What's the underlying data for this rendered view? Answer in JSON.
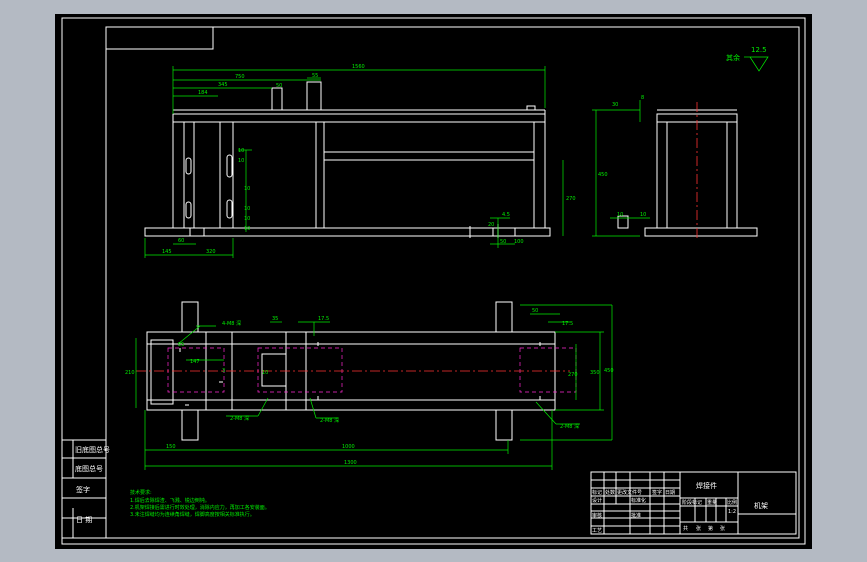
{
  "drawing": {
    "background_color": "#000000",
    "line_color": "#ffffff",
    "dimension_color": "#00ee00",
    "centerline_color": "#ff3333",
    "hidden_line_color": "#ff2ad4"
  },
  "surface_finish": {
    "label": "其余",
    "value": "12.5"
  },
  "front_view": {
    "dims": [
      "1560",
      "750",
      "345",
      "184",
      "55",
      "50",
      "10",
      "10",
      "10",
      "10",
      "10",
      "10",
      "270",
      "60",
      "145",
      "320",
      "4.5",
      "20",
      "50",
      "100"
    ]
  },
  "side_view": {
    "dims": [
      "30",
      "8",
      "450",
      "10",
      "10"
    ]
  },
  "top_view": {
    "dims": [
      "4-M8 深",
      "25",
      "147",
      "3",
      "10",
      "2-M8 深",
      "35",
      "17.5",
      "2-M8 深",
      "50",
      "17.5",
      "270",
      "350",
      "450",
      "2-M8 深",
      "150",
      "1000",
      "1300",
      "210"
    ]
  },
  "side_labels": [
    "旧底图总号",
    "底图总号",
    "签字",
    "日 期"
  ],
  "notes": {
    "title": "技术要求:",
    "lines": [
      "1.焊后去除焊渣、飞溅、锐边倒钝。",
      "2.机架焊接后需进行时效处理，消除内应力，再加工各安装面。",
      "3.未注焊缝均为连续角焊缝，焊脚高度按相关标准执行。"
    ]
  },
  "title_block": {
    "part_name": "焊接件",
    "drawing_title": "机架",
    "row_labels": [
      "标记",
      "处数",
      "更改文件号",
      "签字",
      "日期"
    ],
    "role_labels": [
      "设计",
      "审核",
      "工艺",
      "标准化",
      "批准"
    ],
    "scale_labels": [
      "阶段标记",
      "重量",
      "比例"
    ],
    "sheet_labels": [
      "共",
      "张",
      "第",
      "张"
    ],
    "scale_value": "1:2"
  }
}
